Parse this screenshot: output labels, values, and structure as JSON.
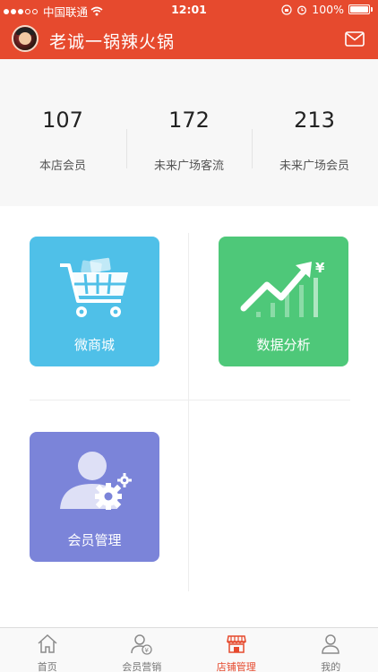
{
  "status_bar": {
    "carrier": "中国联通",
    "time": "12:01",
    "battery": "100%"
  },
  "header": {
    "title": "老诚一锅辣火锅",
    "icons": [
      "avatar",
      "mail-icon"
    ]
  },
  "stats": [
    {
      "value": "107",
      "label": "本店会员"
    },
    {
      "value": "172",
      "label": "未来广场客流"
    },
    {
      "value": "213",
      "label": "未来广场会员"
    }
  ],
  "tiles": [
    {
      "label": "微商城",
      "icon": "shopping-cart-icon",
      "color": "#4fc0e8"
    },
    {
      "label": "数据分析",
      "icon": "trend-chart-icon",
      "color": "#4ec879"
    },
    {
      "label": "会员管理",
      "icon": "member-settings-icon",
      "color": "#7b84d9"
    }
  ],
  "tabbar": {
    "active_color": "#e64a2e",
    "items": [
      {
        "label": "首页",
        "icon": "home-icon"
      },
      {
        "label": "会员营销",
        "icon": "member-marketing-icon"
      },
      {
        "label": "店铺管理",
        "icon": "store-icon"
      },
      {
        "label": "我的",
        "icon": "profile-icon"
      }
    ]
  }
}
